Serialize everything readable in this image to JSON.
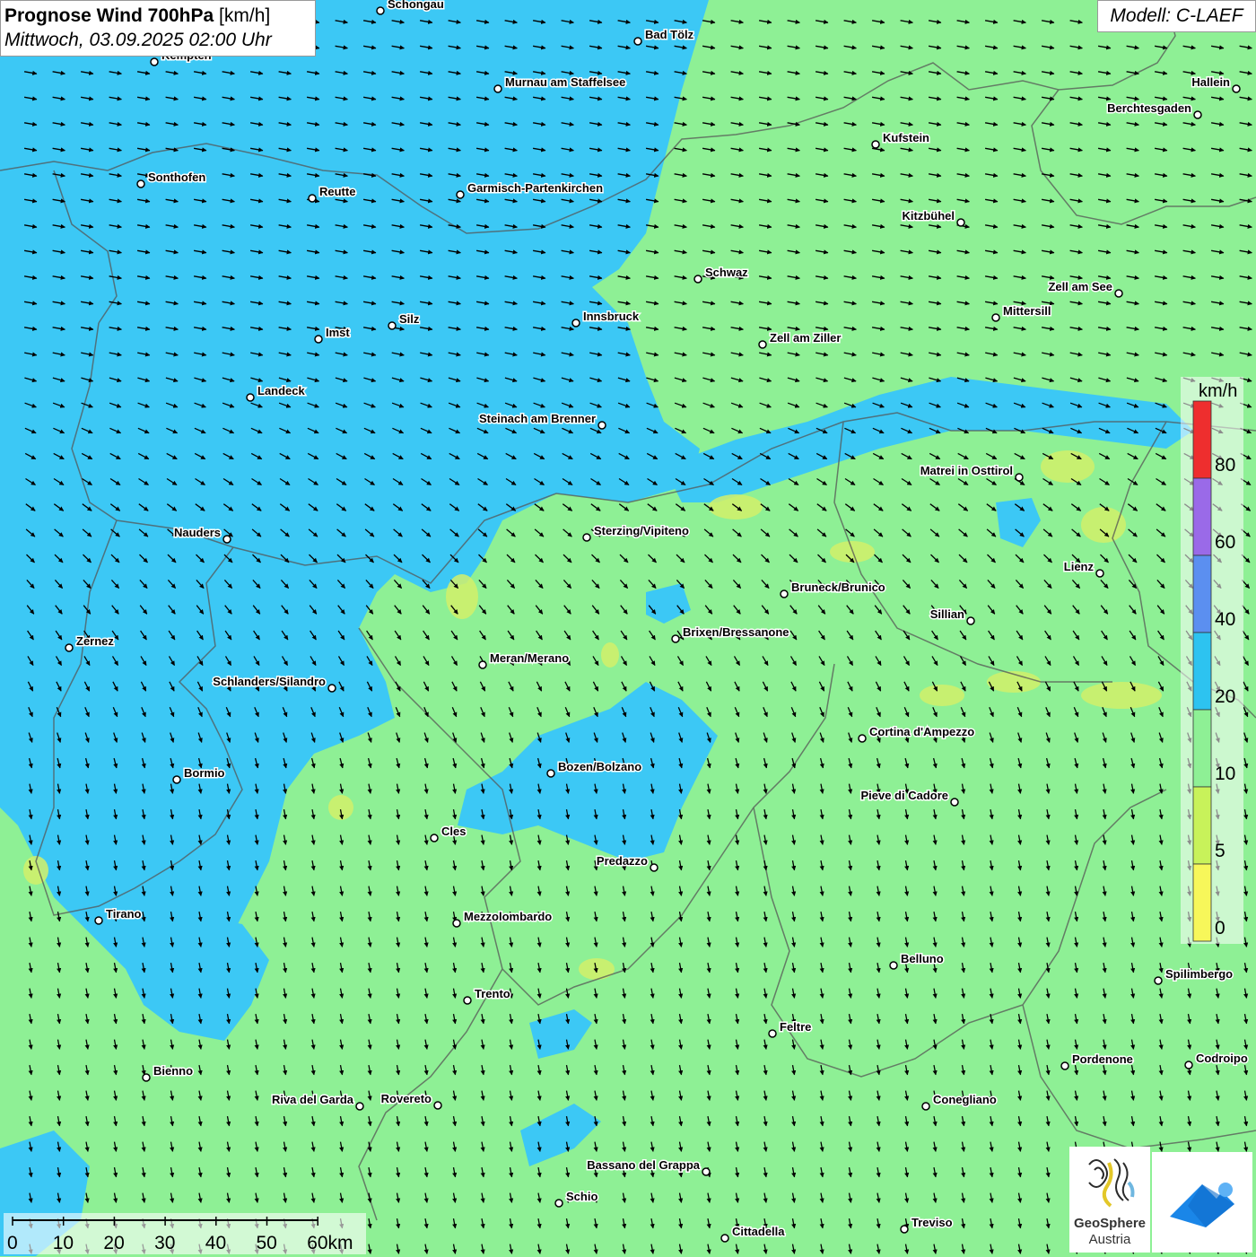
{
  "title": {
    "main": "Prognose Wind 700hPa",
    "unit": "[km/h]",
    "datetime": "Mittwoch, 03.09.2025 02:00 Uhr"
  },
  "model": "Modell: C-LAEF",
  "legend": {
    "unit": "km/h",
    "ticks": [
      "80",
      "60",
      "40",
      "20",
      "10",
      "5",
      "0"
    ],
    "colors": [
      "#ee2e2e",
      "#9a6ae8",
      "#5b8ff0",
      "#2dc3f0",
      "#8ef095",
      "#c8f25a",
      "#f7f75a"
    ]
  },
  "colors": {
    "wind_10_20": "#8ef095",
    "wind_20_40": "#3cc8f5",
    "wind_5_10": "#d2f06a",
    "border": "#555555"
  },
  "cities": [
    {
      "name": "Schongau",
      "label_side": "right"
    },
    {
      "name": "Bad Tölz",
      "label_side": "right"
    },
    {
      "name": "Kempten",
      "label_side": "right"
    },
    {
      "name": "Murnau am Staffelsee",
      "label_side": "right"
    },
    {
      "name": "Hallein",
      "label_side": "left"
    },
    {
      "name": "Berchtesgaden",
      "label_side": "left"
    },
    {
      "name": "Kufstein",
      "label_side": "right"
    },
    {
      "name": "Sonthofen",
      "label_side": "right"
    },
    {
      "name": "Reutte",
      "label_side": "right"
    },
    {
      "name": "Garmisch-Partenkirchen",
      "label_side": "right"
    },
    {
      "name": "Kitzbühel",
      "label_side": "left"
    },
    {
      "name": "Schwaz",
      "label_side": "right"
    },
    {
      "name": "Zell am See",
      "label_side": "left"
    },
    {
      "name": "Innsbruck",
      "label_side": "right"
    },
    {
      "name": "Silz",
      "label_side": "right"
    },
    {
      "name": "Mittersill",
      "label_side": "right"
    },
    {
      "name": "Imst",
      "label_side": "right"
    },
    {
      "name": "Zell am Ziller",
      "label_side": "right"
    },
    {
      "name": "Landeck",
      "label_side": "right"
    },
    {
      "name": "Steinach am Brenner",
      "label_side": "left"
    },
    {
      "name": "Matrei in Osttirol",
      "label_side": "left"
    },
    {
      "name": "Nauders",
      "label_side": "left"
    },
    {
      "name": "Sterzing/Vipiteno",
      "label_side": "right"
    },
    {
      "name": "Lienz",
      "label_side": "left"
    },
    {
      "name": "Bruneck/Brunico",
      "label_side": "right"
    },
    {
      "name": "Sillian",
      "label_side": "left"
    },
    {
      "name": "Brixen/Bressanone",
      "label_side": "right"
    },
    {
      "name": "Zernez",
      "label_side": "right"
    },
    {
      "name": "Meran/Merano",
      "label_side": "right"
    },
    {
      "name": "Schlanders/Silandro",
      "label_side": "left"
    },
    {
      "name": "Cortina d'Ampezzo",
      "label_side": "right"
    },
    {
      "name": "Bozen/Bolzano",
      "label_side": "right"
    },
    {
      "name": "Bormio",
      "label_side": "right"
    },
    {
      "name": "Pieve di Cadore",
      "label_side": "left"
    },
    {
      "name": "Cles",
      "label_side": "right"
    },
    {
      "name": "Predazzo",
      "label_side": "left"
    },
    {
      "name": "Tirano",
      "label_side": "right"
    },
    {
      "name": "Mezzolombardo",
      "label_side": "right"
    },
    {
      "name": "Belluno",
      "label_side": "right"
    },
    {
      "name": "Spilimbergo",
      "label_side": "right"
    },
    {
      "name": "Trento",
      "label_side": "right"
    },
    {
      "name": "Feltre",
      "label_side": "right"
    },
    {
      "name": "Pordenone",
      "label_side": "right"
    },
    {
      "name": "Codroipo",
      "label_side": "right"
    },
    {
      "name": "Bienno",
      "label_side": "right"
    },
    {
      "name": "Riva del Garda",
      "label_side": "left"
    },
    {
      "name": "Rovereto",
      "label_side": "left"
    },
    {
      "name": "Conegliano",
      "label_side": "right"
    },
    {
      "name": "Bassano del Grappa",
      "label_side": "left"
    },
    {
      "name": "Schio",
      "label_side": "right"
    },
    {
      "name": "Treviso",
      "label_side": "right"
    },
    {
      "name": "Cittadella",
      "label_side": "right"
    }
  ],
  "scalebar": {
    "labels": [
      "0",
      "10",
      "20",
      "30",
      "40",
      "50",
      "60km"
    ]
  },
  "logos": {
    "geosphere_name": "GeoSphere",
    "geosphere_sub": "Austria"
  }
}
